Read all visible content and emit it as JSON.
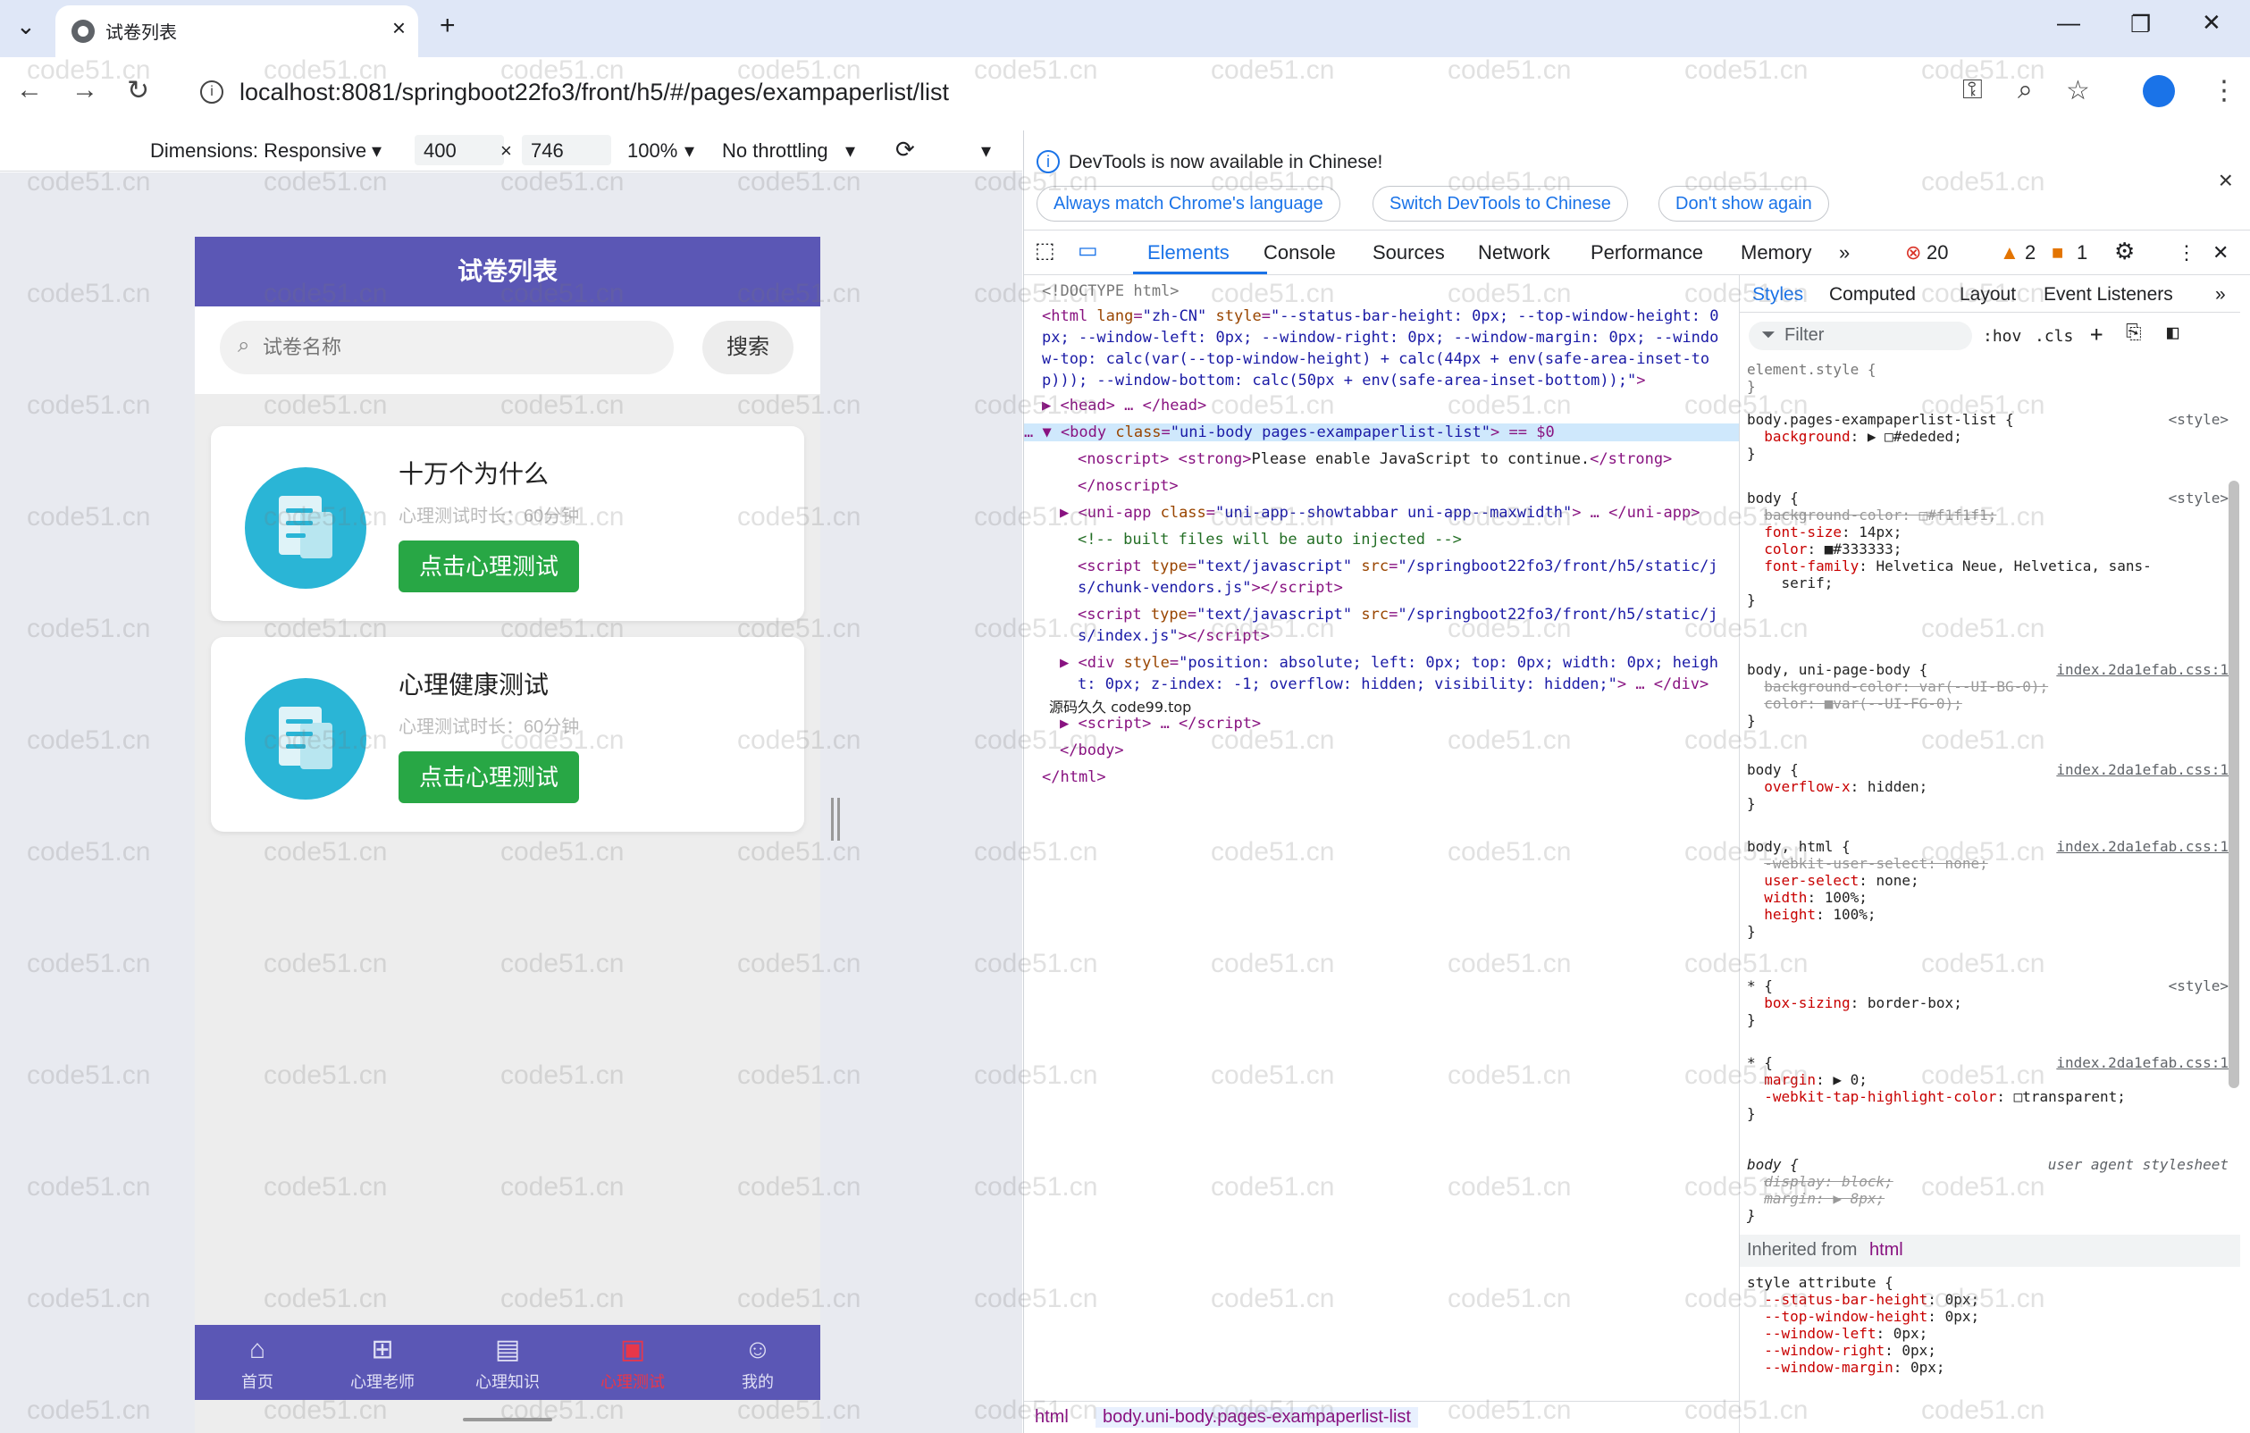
{
  "browser": {
    "tab_title": "试卷列表",
    "url": "localhost:8081/springboot22fo3/front/h5/#/pages/exampaperlist/list"
  },
  "device_toolbar": {
    "dimensions_label": "Dimensions: Responsive",
    "width": "400",
    "times": "×",
    "height": "746",
    "zoom": "100%",
    "throttling": "No throttling"
  },
  "app": {
    "nav_title": "试卷列表",
    "search_placeholder": "试卷名称",
    "search_button": "搜索",
    "cards": [
      {
        "title": "十万个为什么",
        "subtitle": "心理测试时长：60分钟",
        "button": "点击心理测试"
      },
      {
        "title": "心理健康测试",
        "subtitle": "心理测试时长：60分钟",
        "button": "点击心理测试"
      }
    ],
    "tabbar": [
      {
        "label": "首页"
      },
      {
        "label": "心理老师"
      },
      {
        "label": "心理知识"
      },
      {
        "label": "心理测试"
      },
      {
        "label": "我的"
      }
    ]
  },
  "devtools": {
    "info_message": "DevTools is now available in Chinese!",
    "pill_1": "Always match Chrome's language",
    "pill_2": "Switch DevTools to Chinese",
    "pill_3": "Don't show again",
    "tabs": [
      "Elements",
      "Console",
      "Sources",
      "Network",
      "Performance",
      "Memory"
    ],
    "errors": "20",
    "warnings": "2",
    "issues": "1",
    "style_tabs": [
      "Styles",
      "Computed",
      "Layout",
      "Event Listeners"
    ],
    "filter_placeholder": "Filter",
    "hov": ":hov",
    "cls": ".cls",
    "breadcrumb_1": "html",
    "breadcrumb_2": "body.uni-body.pages-exampaperlist-list",
    "inherited_from": "Inherited from",
    "inherited_tag": "html",
    "overlay_text": "源码久久 code99.top"
  },
  "watermark": "code51.cn"
}
